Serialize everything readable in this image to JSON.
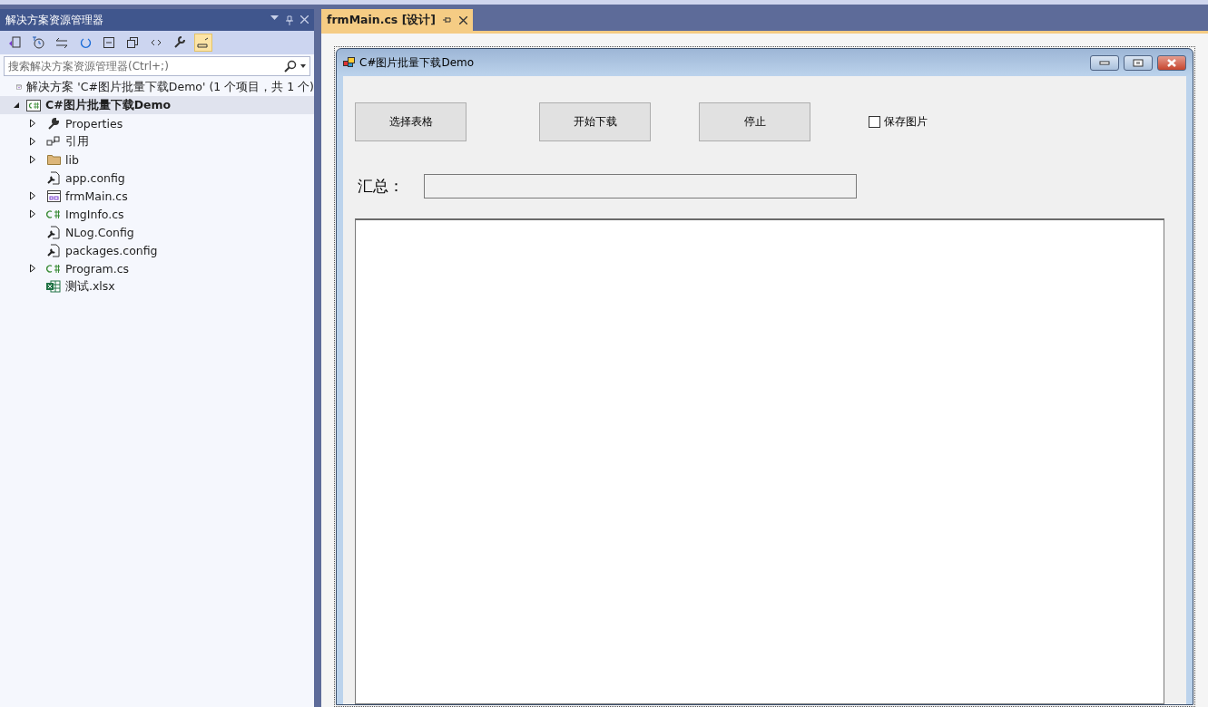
{
  "explorer": {
    "title": "解决方案资源管理器",
    "search": {
      "placeholder": "搜索解决方案资源管理器(Ctrl+;)"
    },
    "solution": "解决方案 'C#图片批量下载Demo' (1 个项目，共 1 个)",
    "project": {
      "label": "C#图片批量下载Demo",
      "expanded": true,
      "selected": true,
      "children": [
        {
          "label": "Properties",
          "kind": "wrench",
          "expanded": false
        },
        {
          "label": "引用",
          "kind": "references",
          "expanded": false
        },
        {
          "label": "lib",
          "kind": "folder",
          "expanded": false
        },
        {
          "label": "app.config",
          "kind": "config"
        },
        {
          "label": "frmMain.cs",
          "kind": "form",
          "expanded": false
        },
        {
          "label": "ImgInfo.cs",
          "kind": "csharp",
          "expanded": false
        },
        {
          "label": "NLog.Config",
          "kind": "config"
        },
        {
          "label": "packages.config",
          "kind": "config"
        },
        {
          "label": "Program.cs",
          "kind": "csharp",
          "expanded": false
        },
        {
          "label": "测试.xlsx",
          "kind": "excel"
        }
      ]
    }
  },
  "tab": {
    "label": "frmMain.cs [设计]",
    "selected": true
  },
  "form": {
    "title": "C#图片批量下载Demo",
    "buttons": [
      "选择表格",
      "开始下载",
      "停止"
    ],
    "checkbox": {
      "label": "保存图片",
      "checked": false
    },
    "summary_label": "汇总："
  }
}
